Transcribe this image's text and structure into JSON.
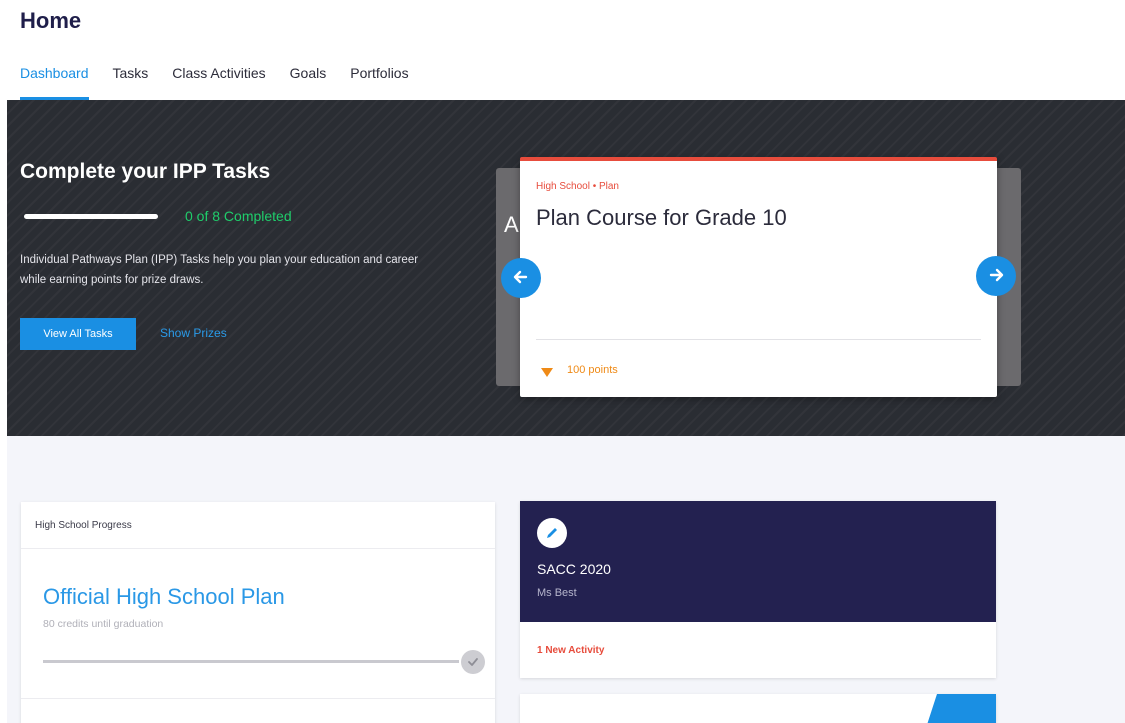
{
  "page": {
    "title": "Home"
  },
  "tabs": [
    {
      "label": "Dashboard",
      "active": true
    },
    {
      "label": "Tasks",
      "active": false
    },
    {
      "label": "Class Activities",
      "active": false
    },
    {
      "label": "Goals",
      "active": false
    },
    {
      "label": "Portfolios",
      "active": false
    }
  ],
  "hero": {
    "title": "Complete your IPP Tasks",
    "progress_text": "0 of 8 Completed",
    "progress_completed": 0,
    "progress_total": 8,
    "description": "Individual Pathways Plan (IPP) Tasks help you plan your education and career while earning points for prize draws.",
    "view_all_label": "View All Tasks",
    "show_prizes_label": "Show Prizes",
    "task_card": {
      "tag": "High School • Plan",
      "title": "Plan Course for Grade 10",
      "points": "100 points",
      "points_icon": "heart-icon"
    },
    "peek_card_text": "A",
    "arrow_prev_icon": "arrow-left-icon",
    "arrow_next_icon": "arrow-right-icon"
  },
  "progress_card": {
    "header": "High School Progress",
    "title": "Official High School Plan",
    "subtitle": "80 credits until graduation",
    "check_icon": "check-icon"
  },
  "class_card": {
    "icon": "pen-icon",
    "name": "SACC 2020",
    "teacher": "Ms Best",
    "activity": "1 New Activity"
  },
  "colors": {
    "accent": "#1a8fe3",
    "hero_bg": "#2a2d33",
    "success": "#1fcd6b",
    "alert": "#e74c3c",
    "points": "#ef8a16",
    "class_card_bg": "#232150"
  }
}
